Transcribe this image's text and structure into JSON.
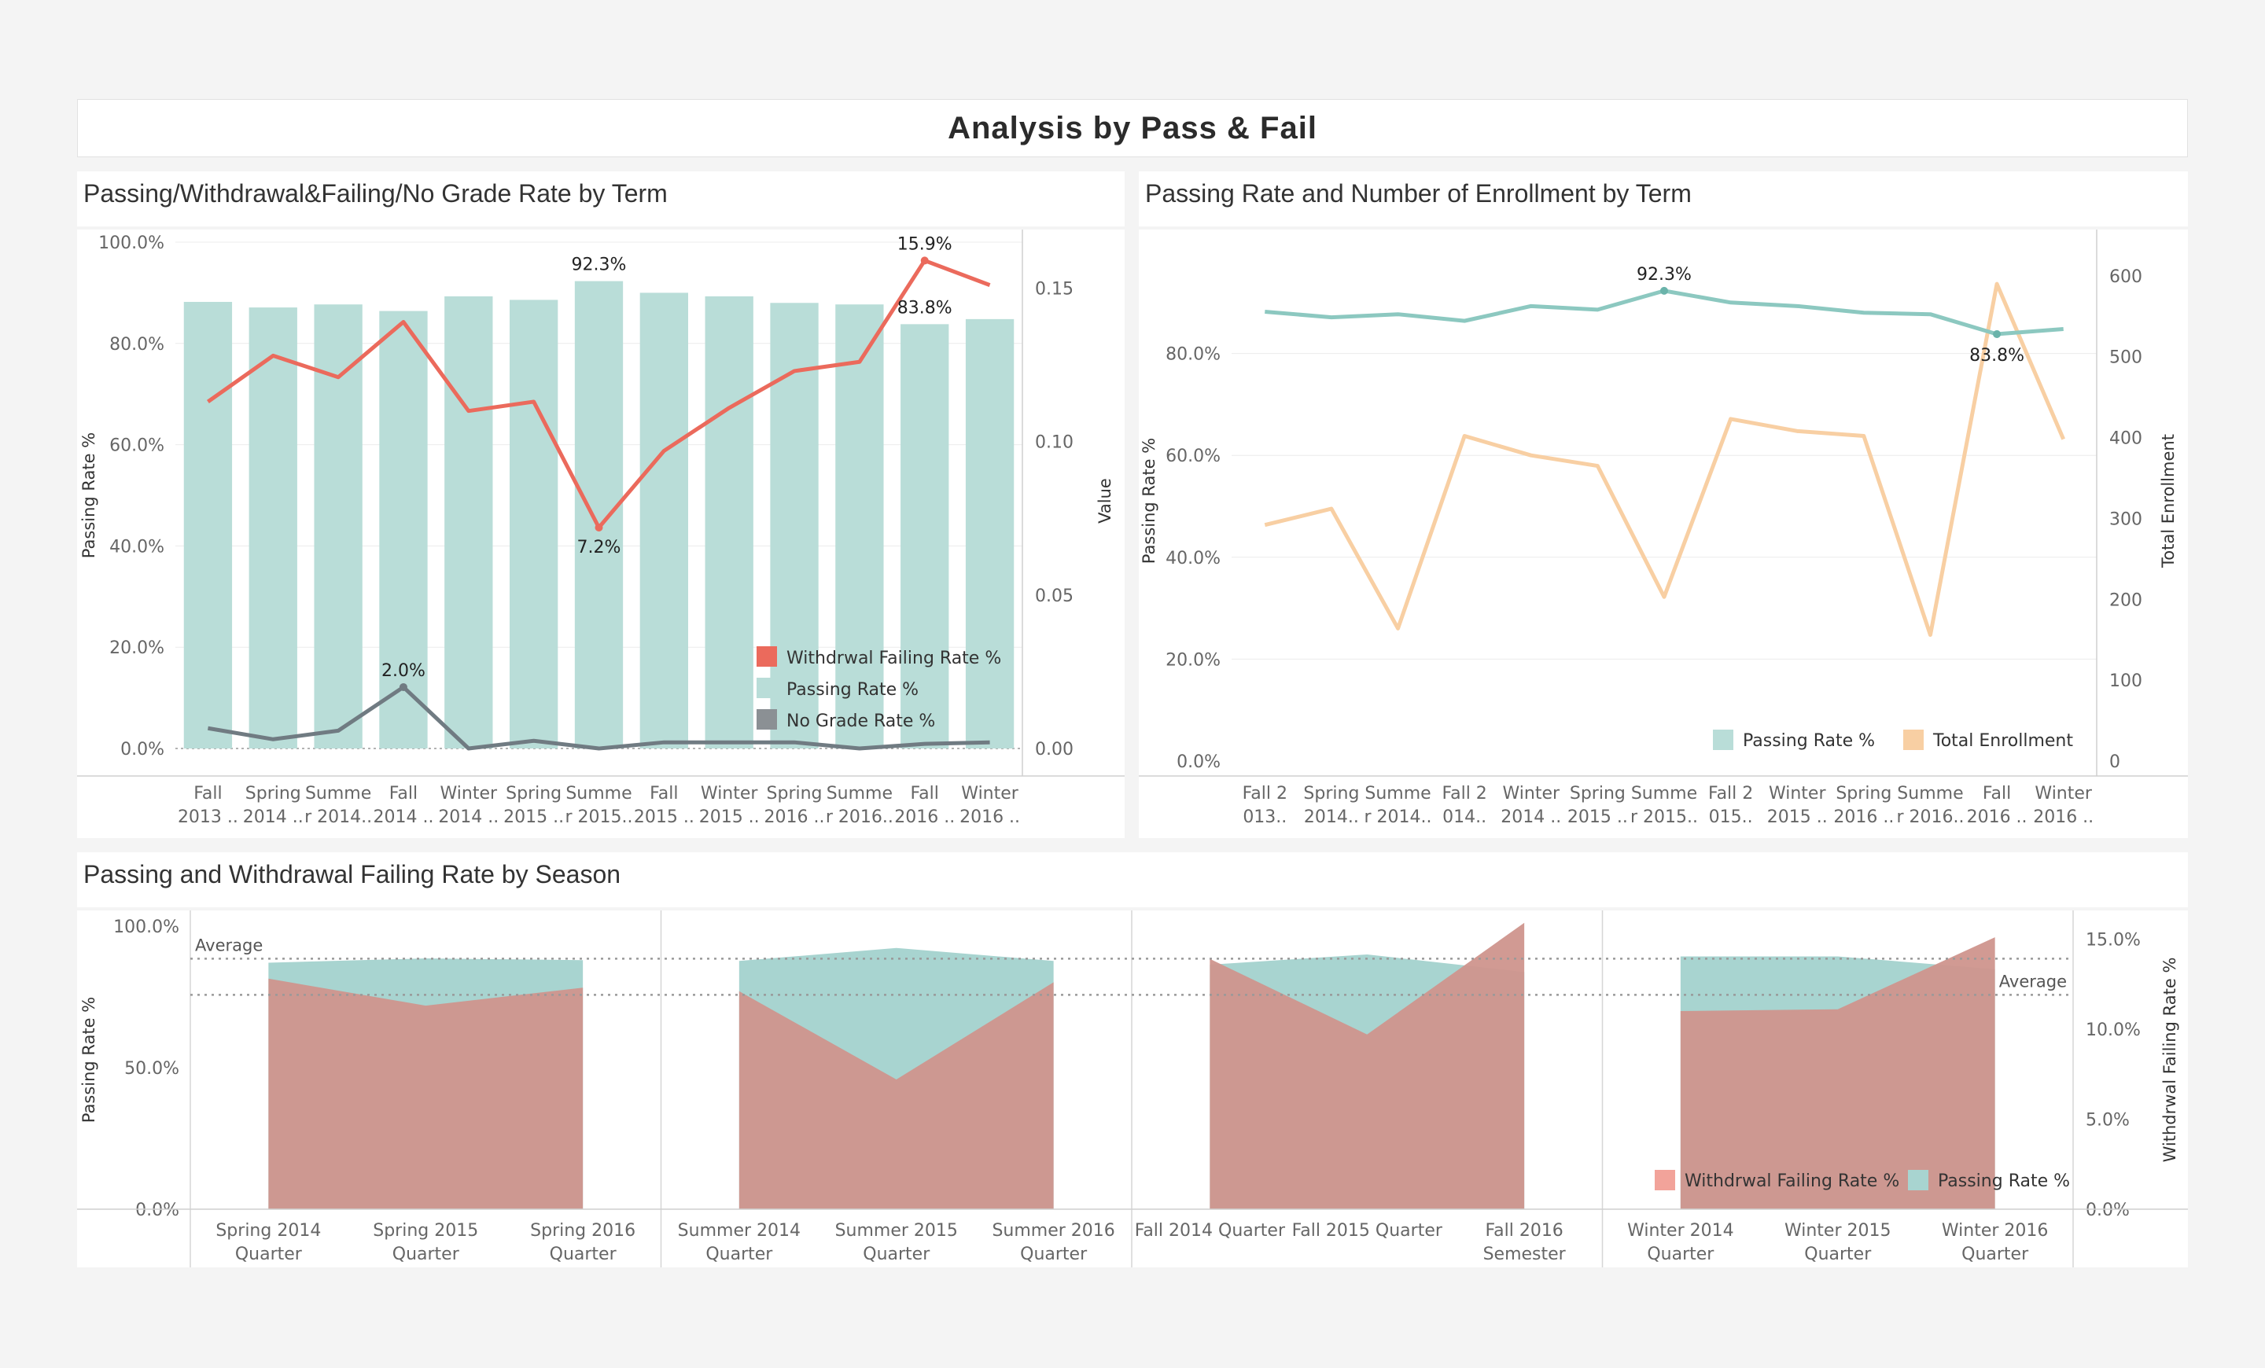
{
  "page_title": "Analysis by Pass & Fail",
  "colors": {
    "passing": "#b9ddd8",
    "passing_line": "#8cc8c0",
    "withdrawal": "#eb6a5c",
    "no_grade": "#707b82",
    "enrollment": "#f8cfa3",
    "area_passing": "#a8d4d0",
    "area_withdrawal": "#cf958d",
    "area_withdrawal_light": "#f2a39a"
  },
  "chart_data": [
    {
      "type": "bar",
      "title": "Passing/Withdrawal&Failing/No Grade Rate by Term",
      "categories": [
        "Fall 2013 ..",
        "Spring 2014 ..",
        "Summer 2014..",
        "Fall 2014 ..",
        "Winter 2014 ..",
        "Spring 2015 ..",
        "Summer 2015..",
        "Fall 2015 ..",
        "Winter 2015 ..",
        "Spring 2016 ..",
        "Summer 2016..",
        "Fall 2016 ..",
        "Winter 2016 .."
      ],
      "category_lines": [
        [
          "Fall",
          "2013 .."
        ],
        [
          "Spring",
          "2014 .."
        ],
        [
          "Summe",
          "r 2014.."
        ],
        [
          "Fall",
          "2014 .."
        ],
        [
          "Winter",
          "2014 .."
        ],
        [
          "Spring",
          "2015 .."
        ],
        [
          "Summe",
          "r 2015.."
        ],
        [
          "Fall",
          "2015 .."
        ],
        [
          "Winter",
          "2015 .."
        ],
        [
          "Spring",
          "2016 .."
        ],
        [
          "Summe",
          "r 2016.."
        ],
        [
          "Fall",
          "2016 .."
        ],
        [
          "Winter",
          "2016 .."
        ]
      ],
      "ylabel": "Passing Rate %",
      "y2label": "Value",
      "ylim": [
        0,
        100
      ],
      "y2lim": [
        0,
        0.165
      ],
      "yticks": [
        "100.0%",
        "80.0%",
        "60.0%",
        "40.0%",
        "20.0%",
        "0.0%"
      ],
      "y2ticks": [
        "0.15",
        "0.10",
        "0.05",
        "0.00"
      ],
      "series": [
        {
          "name": "Passing Rate %",
          "type": "bar",
          "axis": "left",
          "values": [
            88.2,
            87.1,
            87.7,
            86.4,
            89.3,
            88.6,
            92.3,
            90.0,
            89.3,
            88.0,
            87.7,
            83.8,
            84.8
          ]
        },
        {
          "name": "Withdrwal Failing Rate %",
          "type": "line",
          "axis": "right",
          "values": [
            0.113,
            0.128,
            0.121,
            0.139,
            0.11,
            0.113,
            0.072,
            0.097,
            0.111,
            0.123,
            0.126,
            0.159,
            0.151
          ]
        },
        {
          "name": "No Grade Rate %",
          "type": "line",
          "axis": "right",
          "values": [
            0.0066,
            0.003,
            0.0058,
            0.02,
            0.0,
            0.0025,
            0.0,
            0.002,
            0.002,
            0.002,
            0.0,
            0.0015,
            0.002
          ]
        }
      ],
      "data_labels": [
        {
          "series": 0,
          "index": 6,
          "text": "92.3%"
        },
        {
          "series": 0,
          "index": 11,
          "text": "83.8%"
        },
        {
          "series": 1,
          "index": 6,
          "text": "7.2%"
        },
        {
          "series": 1,
          "index": 11,
          "text": "15.9%"
        },
        {
          "series": 2,
          "index": 3,
          "text": "2.0%"
        }
      ],
      "legend": [
        "Withdrwal Failing Rate %",
        "Passing Rate %",
        "No Grade Rate %"
      ],
      "legend_position": "bottom-right"
    },
    {
      "type": "line",
      "title": "Passing Rate and Number of Enrollment by Term",
      "categories": [
        "Fall 2013..",
        "Spring 2014..",
        "Summer 2014..",
        "Fall 2014..",
        "Winter 2014 ..",
        "Spring 2015 ..",
        "Summer 2015..",
        "Fall 2015..",
        "Winter 2015 ..",
        "Spring 2016 ..",
        "Summer 2016..",
        "Fall 2016 ..",
        "Winter 2016 .."
      ],
      "category_lines": [
        [
          "Fall 2",
          "013.."
        ],
        [
          "Spring",
          "2014.."
        ],
        [
          "Summe",
          "r 2014.."
        ],
        [
          "Fall 2",
          "014.."
        ],
        [
          "Winter",
          "2014 .."
        ],
        [
          "Spring",
          "2015 .."
        ],
        [
          "Summe",
          "r 2015.."
        ],
        [
          "Fall 2",
          "015.."
        ],
        [
          "Winter",
          "2015 .."
        ],
        [
          "Spring",
          "2016 .."
        ],
        [
          "Summe",
          "r 2016.."
        ],
        [
          "Fall",
          "2016 .."
        ],
        [
          "Winter",
          "2016 .."
        ]
      ],
      "ylabel": "Passing Rate %",
      "y2label": "Total Enrollment",
      "ylim": [
        0,
        100
      ],
      "y2lim": [
        0,
        630
      ],
      "yticks": [
        "80.0%",
        "60.0%",
        "40.0%",
        "20.0%",
        "0.0%"
      ],
      "y2ticks": [
        "600",
        "500",
        "400",
        "300",
        "200",
        "100",
        "0"
      ],
      "series": [
        {
          "name": "Passing Rate %",
          "axis": "left",
          "values": [
            88.2,
            87.1,
            87.7,
            86.4,
            89.3,
            88.6,
            92.3,
            90.0,
            89.3,
            88.0,
            87.7,
            83.8,
            84.8
          ]
        },
        {
          "name": "Total Enrollment",
          "axis": "right",
          "values": [
            292,
            312,
            164,
            402,
            378,
            365,
            203,
            423,
            408,
            402,
            156,
            590,
            398
          ]
        }
      ],
      "data_labels": [
        {
          "series": 0,
          "index": 6,
          "text": "92.3%"
        },
        {
          "series": 0,
          "index": 11,
          "text": "83.8%"
        }
      ],
      "legend": [
        "Passing Rate %",
        "Total Enrollment"
      ],
      "legend_position": "bottom-right"
    },
    {
      "type": "area",
      "title": "Passing and Withdrawal Failing Rate by Season",
      "ylabel": "Passing Rate %",
      "y2label": "Withdrwal Failing Rate %",
      "ylim": [
        0,
        105
      ],
      "y2lim": [
        0,
        16.5
      ],
      "yticks": [
        "100.0%",
        "50.0%",
        "0.0%"
      ],
      "y2ticks": [
        "15.0%",
        "10.0%",
        "5.0%",
        "0.0%"
      ],
      "average_label": "Average",
      "average_passing": 88.5,
      "average_withdrawal": 11.9,
      "panels": [
        {
          "name": "Spring",
          "categories": [
            [
              "Spring 2014",
              "Quarter"
            ],
            [
              "Spring 2015",
              "Quarter"
            ],
            [
              "Spring 2016",
              "Quarter"
            ]
          ],
          "passing": [
            87.1,
            88.6,
            88.0
          ],
          "withdrawal": [
            12.8,
            11.3,
            12.3
          ]
        },
        {
          "name": "Summer",
          "categories": [
            [
              "Summer 2014",
              "Quarter"
            ],
            [
              "Summer 2015",
              "Quarter"
            ],
            [
              "Summer 2016",
              "Quarter"
            ]
          ],
          "passing": [
            87.7,
            92.3,
            87.7
          ],
          "withdrawal": [
            12.1,
            7.2,
            12.6
          ]
        },
        {
          "name": "Fall",
          "categories": [
            [
              "Fall 2014 Quarter",
              ""
            ],
            [
              "Fall 2015 Quarter",
              ""
            ],
            [
              "Fall 2016",
              "Semester"
            ]
          ],
          "passing": [
            86.4,
            90.0,
            83.8
          ],
          "withdrawal": [
            13.9,
            9.7,
            15.9
          ]
        },
        {
          "name": "Winter",
          "categories": [
            [
              "Winter 2014",
              "Quarter"
            ],
            [
              "Winter 2015",
              "Quarter"
            ],
            [
              "Winter 2016",
              "Quarter"
            ]
          ],
          "passing": [
            89.3,
            89.3,
            84.8
          ],
          "withdrawal": [
            11.0,
            11.1,
            15.1
          ]
        }
      ],
      "legend": [
        "Withdrwal Failing Rate %",
        "Passing Rate %"
      ],
      "legend_position": "bottom-right"
    }
  ]
}
